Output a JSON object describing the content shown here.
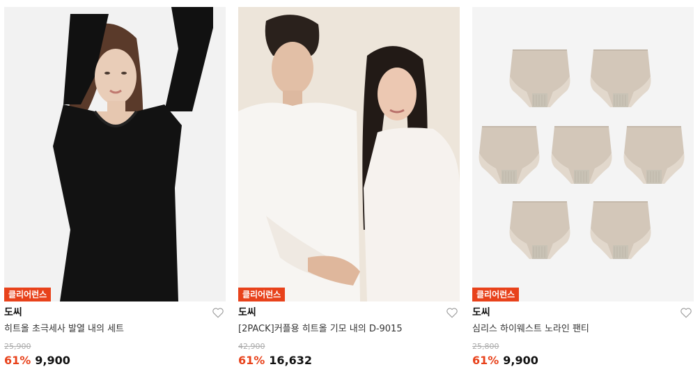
{
  "colors": {
    "accent": "#e8421b",
    "panty": "#d6cbbe",
    "lace": "#e0d6ca"
  },
  "products": [
    {
      "badge": "클리어런스",
      "brand": "도씨",
      "title": "히트올 초극세사 발열 내의 세트",
      "original_price": "25,900",
      "discount": "61%",
      "price": "9,900",
      "image": "woman-black-thermal-top-photo"
    },
    {
      "badge": "클리어런스",
      "brand": "도씨",
      "title": "[2PACK]커플용 히트올 기모 내의 D-9015",
      "original_price": "42,900",
      "discount": "61%",
      "price": "16,632",
      "image": "couple-white-thermal-photo"
    },
    {
      "badge": "클리어런스",
      "brand": "도씨",
      "title": "심리스 하이웨스트 노라인 팬티",
      "original_price": "25,800",
      "discount": "61%",
      "price": "9,900",
      "image": "beige-panties-grid-photo"
    }
  ]
}
